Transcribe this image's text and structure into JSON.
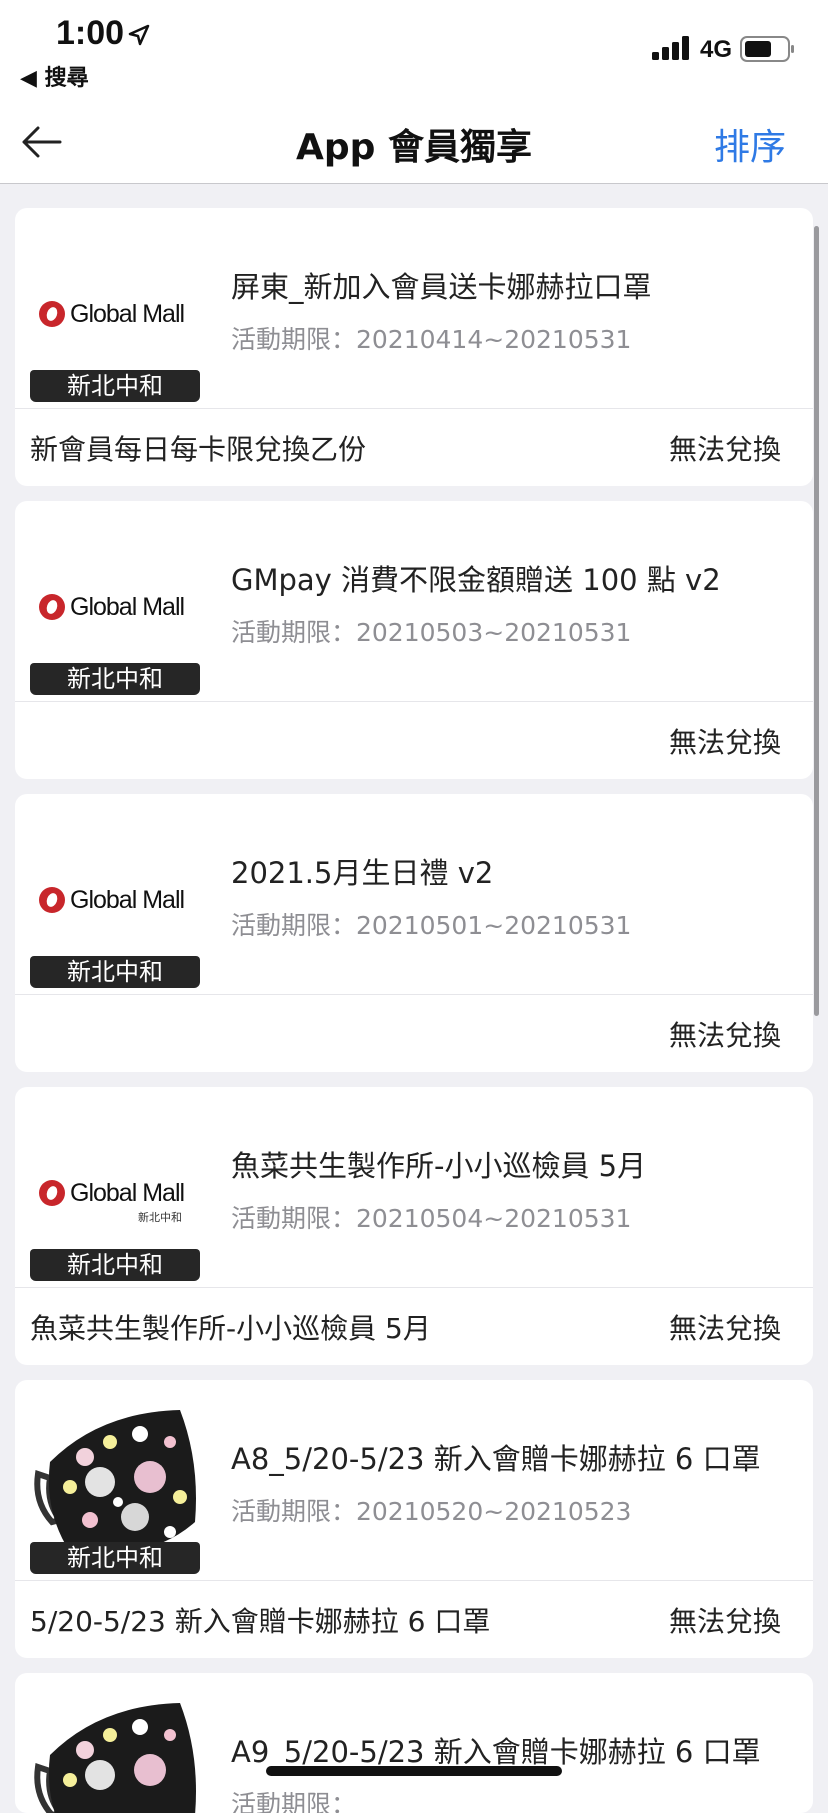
{
  "status_bar": {
    "time": "1:00",
    "back_app": "◀ 搜尋",
    "network": "4G",
    "location_icon": "location-arrow-icon",
    "signal_icon": "signal-bars-icon",
    "battery_icon": "battery-icon"
  },
  "nav": {
    "title": "App 會員獨享",
    "sort_label": "排序",
    "back_icon": "back-arrow-icon"
  },
  "logo": {
    "brand": "Global Mall",
    "sub": "新北中和",
    "accent": "#c8262b"
  },
  "colors": {
    "accent_blue": "#2f7ae5",
    "badge_bg": "#262626",
    "period_gray": "#8e8e93"
  },
  "coupons": [
    {
      "thumb_type": "logo",
      "store": "新北中和",
      "title": "屏東_新加入會員送卡娜赫拉口罩",
      "period": "活動期限：20210414~20210531",
      "note": "新會員每日每卡限兌換乙份",
      "status": "無法兌換"
    },
    {
      "thumb_type": "logo",
      "store": "新北中和",
      "title": "GMpay 消費不限金額贈送 100 點 v2",
      "period": "活動期限：20210503~20210531",
      "note": "",
      "status": "無法兌換"
    },
    {
      "thumb_type": "logo",
      "store": "新北中和",
      "title": "2021.5月生日禮 v2",
      "period": "活動期限：20210501~20210531",
      "note": "",
      "status": "無法兌換"
    },
    {
      "thumb_type": "logo-sub",
      "store": "新北中和",
      "title": "魚菜共生製作所-小小巡檢員 5月",
      "period": "活動期限：20210504~20210531",
      "note": "魚菜共生製作所-小小巡檢員 5月",
      "status": "無法兌換"
    },
    {
      "thumb_type": "mask",
      "store": "新北中和",
      "title": "A8_5/20-5/23 新入會贈卡娜赫拉 6 口罩",
      "period": "活動期限：20210520~20210523",
      "note": "5/20-5/23 新入會贈卡娜赫拉 6 口罩",
      "status": "無法兌換"
    },
    {
      "thumb_type": "mask",
      "store": "",
      "title": "A9_5/20-5/23 新入會贈卡娜赫拉 6 口罩",
      "period": "活動期限：",
      "note": "",
      "status": ""
    }
  ]
}
